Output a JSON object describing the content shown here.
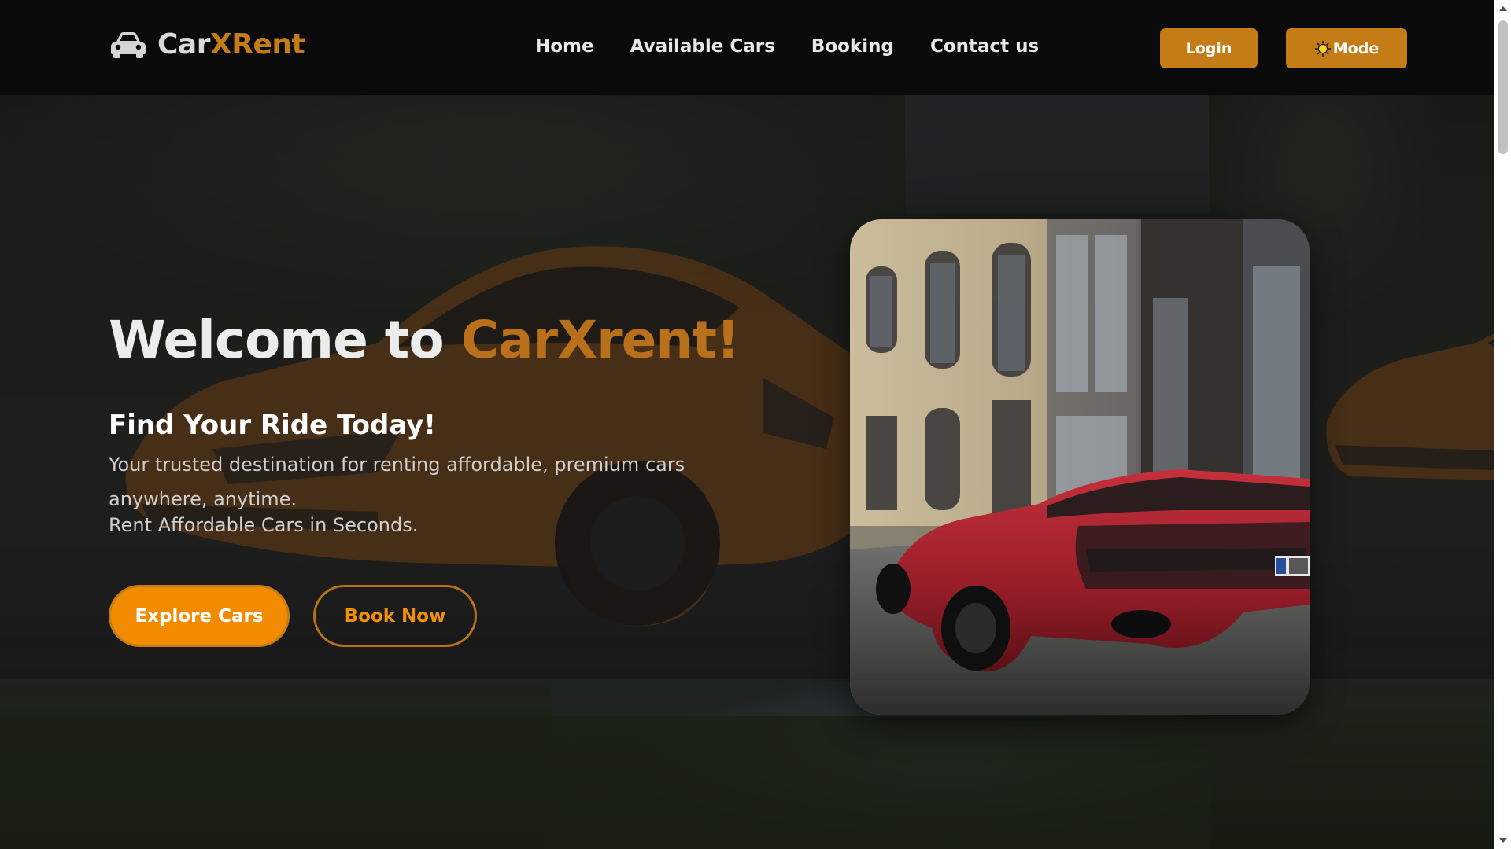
{
  "brand": {
    "part1": "Car",
    "part2": "XRent",
    "icon": "car-icon"
  },
  "nav": {
    "items": [
      {
        "label": "Home"
      },
      {
        "label": "Available Cars"
      },
      {
        "label": "Booking"
      },
      {
        "label": "Contact us"
      }
    ]
  },
  "header_buttons": {
    "login_label": "Login",
    "mode_label": "Mode",
    "mode_icon": "sun-icon"
  },
  "hero": {
    "welcome_prefix": "Welcome to ",
    "welcome_brand": "CarXrent!",
    "subtitle": "Find Your Ride Today!",
    "tagline": "Your trusted destination for renting affordable, premium cars anywhere, anytime.",
    "tagline2": "Rent Affordable Cars in Seconds.",
    "explore_label": "Explore Cars",
    "book_label": "Book Now"
  },
  "colors": {
    "accent": "#c47c16",
    "accent_bright": "#f28b00",
    "header_bg": "#0a0a0a",
    "text_light": "#e8e8e8"
  }
}
